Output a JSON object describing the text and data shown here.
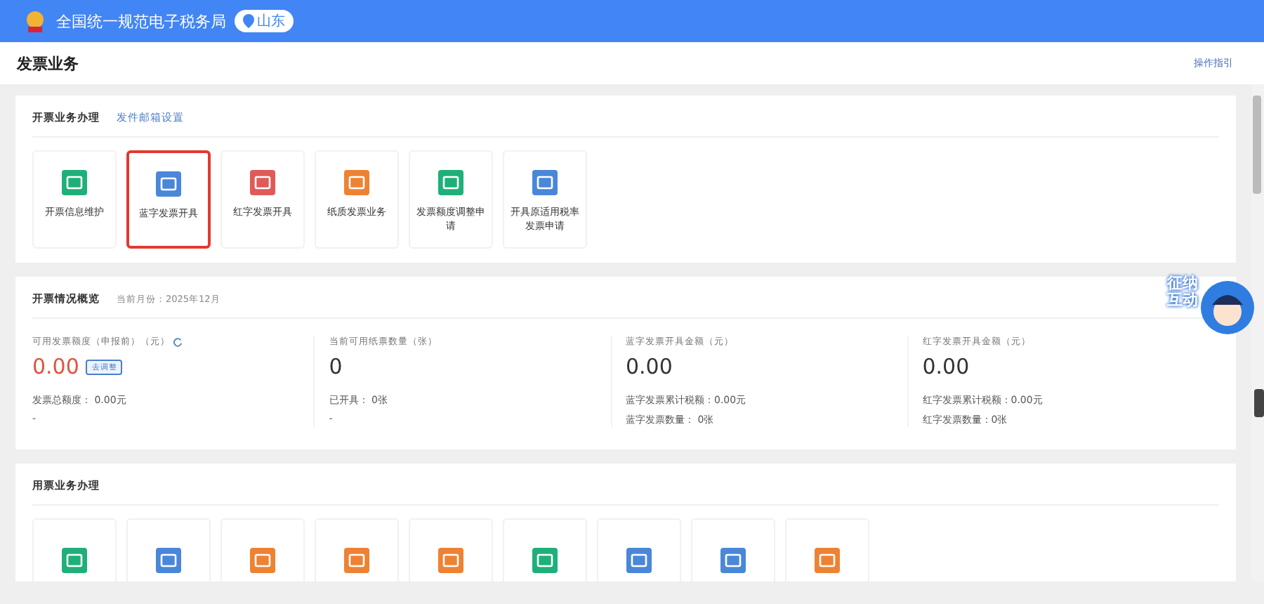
{
  "header": {
    "site_title": "全国统一规范电子税务局",
    "region": "山东"
  },
  "page": {
    "title": "发票业务",
    "guide_link": "操作指引"
  },
  "issuing": {
    "title": "开票业务办理",
    "settings_link": "发件邮箱设置",
    "tiles": [
      {
        "label": "开票信息维护",
        "color": "#1fb07a",
        "selected": false
      },
      {
        "label": "蓝字发票开具",
        "color": "#4a87d9",
        "selected": true
      },
      {
        "label": "红字发票开具",
        "color": "#e05a5a",
        "selected": false
      },
      {
        "label": "纸质发票业务",
        "color": "#ee8233",
        "selected": false
      },
      {
        "label": "发票额度调整申请",
        "color": "#1fb07a",
        "selected": false
      },
      {
        "label": "开具原适用税率发票申请",
        "color": "#4a87d9",
        "selected": false
      }
    ]
  },
  "overview": {
    "title": "开票情况概览",
    "month": "当前月份：2025年12月",
    "columns": [
      {
        "label": "可用发票额度（申报前）（元）",
        "value": "0.00",
        "alert": true,
        "refresh": true,
        "adjust_button": "去调整",
        "lines": [
          "发票总额度： 0.00元",
          "-"
        ]
      },
      {
        "label": "当前可用纸票数量（张）",
        "value": "0",
        "alert": false,
        "refresh": false,
        "lines": [
          "已开具： 0张",
          "-"
        ]
      },
      {
        "label": "蓝字发票开具金额（元）",
        "value": "0.00",
        "alert": false,
        "refresh": false,
        "lines": [
          "蓝字发票累计税额：0.00元",
          "蓝字发票数量： 0张"
        ]
      },
      {
        "label": "红字发票开具金额（元）",
        "value": "0.00",
        "alert": false,
        "refresh": false,
        "lines": [
          "红字发票累计税额：0.00元",
          "红字发票数量：0张"
        ]
      }
    ]
  },
  "usage": {
    "title": "用票业务办理",
    "tiles": [
      {
        "color": "#1fb07a"
      },
      {
        "color": "#4a87d9"
      },
      {
        "color": "#ee8233"
      },
      {
        "color": "#ee8233"
      },
      {
        "color": "#ee8233"
      },
      {
        "color": "#1fb07a"
      },
      {
        "color": "#4a87d9"
      },
      {
        "color": "#4a87d9"
      },
      {
        "color": "#ee8233"
      }
    ]
  },
  "assistant": {
    "label": "征纳互动"
  }
}
